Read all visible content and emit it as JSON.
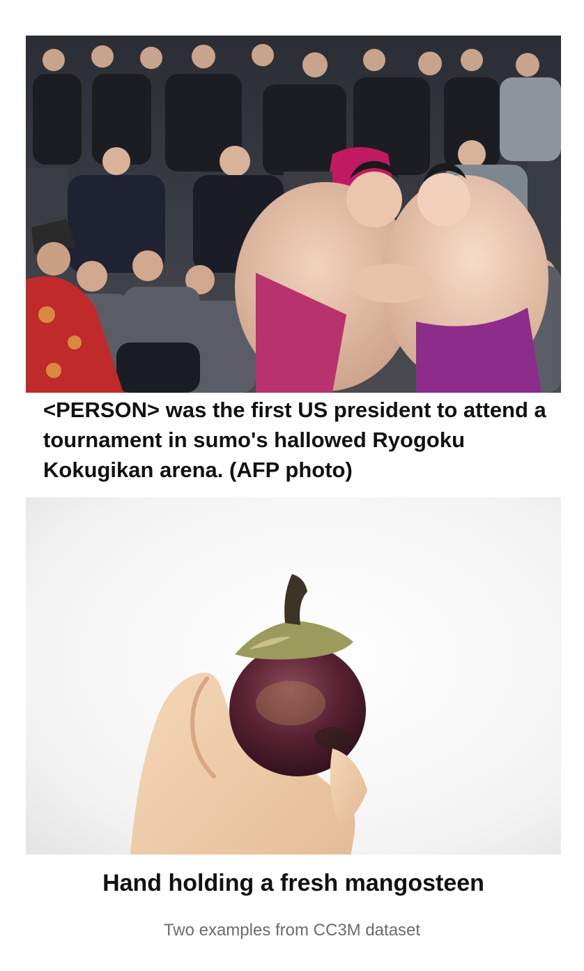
{
  "examples": [
    {
      "image_subject": "sumo-match-photo",
      "caption": "<PERSON> was the first US president to attend a tournament in sumo's hallowed Ryogoku Kokugikan arena. (AFP photo)"
    },
    {
      "image_subject": "mangosteen-photo",
      "caption": "Hand holding a fresh mangosteen"
    }
  ],
  "figure_caption": "Two examples from CC3M dataset",
  "colors": {
    "caption_text": "#111111",
    "figure_caption_text": "#6b6b6b",
    "mawashi": "#b8326e",
    "mangosteen": "#5a2233"
  }
}
